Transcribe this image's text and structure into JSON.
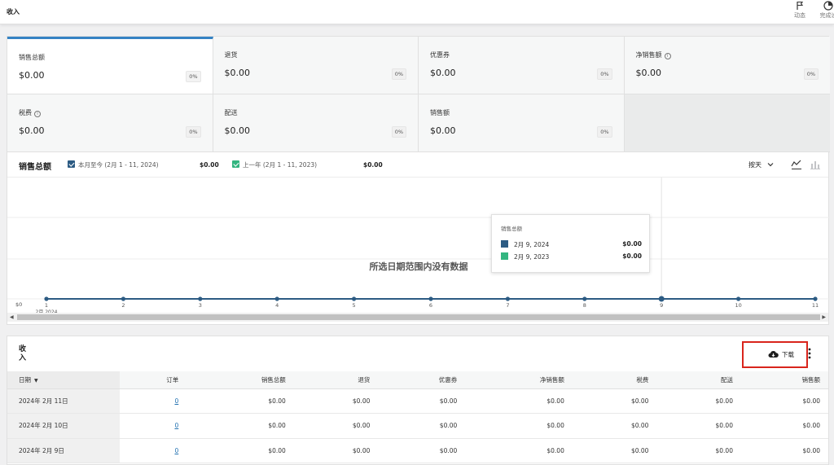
{
  "header": {
    "title": "收入",
    "actions": [
      {
        "label": "动态",
        "icon": "flag-icon"
      },
      {
        "label": "完成设",
        "icon": "progress-icon"
      }
    ]
  },
  "summary": {
    "tiles": [
      {
        "label": "销售总额",
        "value": "$0.00",
        "pct": "0%",
        "info": false
      },
      {
        "label": "退货",
        "value": "$0.00",
        "pct": "0%",
        "info": false
      },
      {
        "label": "优惠券",
        "value": "$0.00",
        "pct": "0%",
        "info": false
      },
      {
        "label": "净销售额",
        "value": "$0.00",
        "pct": "0%",
        "info": true
      },
      {
        "label": "税费",
        "value": "$0.00",
        "pct": "0%",
        "info": true
      },
      {
        "label": "配送",
        "value": "$0.00",
        "pct": "0%",
        "info": false
      },
      {
        "label": "销售额",
        "value": "$0.00",
        "pct": "0%",
        "info": false
      }
    ]
  },
  "chart": {
    "title": "销售总额",
    "legend": [
      {
        "label": "本月至今 (2月 1 - 11, 2024)",
        "value": "$0.00",
        "color": "#2c5b83"
      },
      {
        "label": "上一年 (2月 1 - 11, 2023)",
        "value": "$0.00",
        "color": "#33b580"
      }
    ],
    "interval": "按天",
    "no_data": "所选日期范围内没有数据",
    "y_tick": "$0",
    "x_sub_label": "2月 2024",
    "tooltip": {
      "title": "销售总额",
      "rows": [
        {
          "date": "2月 9, 2024",
          "value": "$0.00",
          "color": "#2c5b83"
        },
        {
          "date": "2月 9, 2023",
          "value": "$0.00",
          "color": "#33b580"
        }
      ]
    }
  },
  "chart_data": {
    "type": "line",
    "title": "销售总额",
    "xlabel": "",
    "ylabel": "",
    "x": [
      "1",
      "2",
      "3",
      "4",
      "5",
      "6",
      "7",
      "8",
      "9",
      "10",
      "11"
    ],
    "series": [
      {
        "name": "本月至今 (2月 1 - 11, 2024)",
        "values": [
          0,
          0,
          0,
          0,
          0,
          0,
          0,
          0,
          0,
          0,
          0
        ]
      }
    ],
    "grid": true,
    "highlight_index": 8
  },
  "table": {
    "title": "收入",
    "download_label": "下载",
    "columns": [
      "日期",
      "订单",
      "销售总额",
      "退货",
      "优惠券",
      "净销售额",
      "税费",
      "配送",
      "销售额"
    ],
    "rows": [
      [
        "2024年 2月 11日",
        "0",
        "$0.00",
        "$0.00",
        "$0.00",
        "$0.00",
        "$0.00",
        "$0.00",
        "$0.00"
      ],
      [
        "2024年 2月 10日",
        "0",
        "$0.00",
        "$0.00",
        "$0.00",
        "$0.00",
        "$0.00",
        "$0.00",
        "$0.00"
      ],
      [
        "2024年 2月 9日",
        "0",
        "$0.00",
        "$0.00",
        "$0.00",
        "$0.00",
        "$0.00",
        "$0.00",
        "$0.00"
      ]
    ]
  },
  "colors": {
    "accent": "#3582c4",
    "series_current": "#2c5b83",
    "series_previous": "#33b580",
    "highlight_border": "#d9251c",
    "link": "#2271b1"
  }
}
